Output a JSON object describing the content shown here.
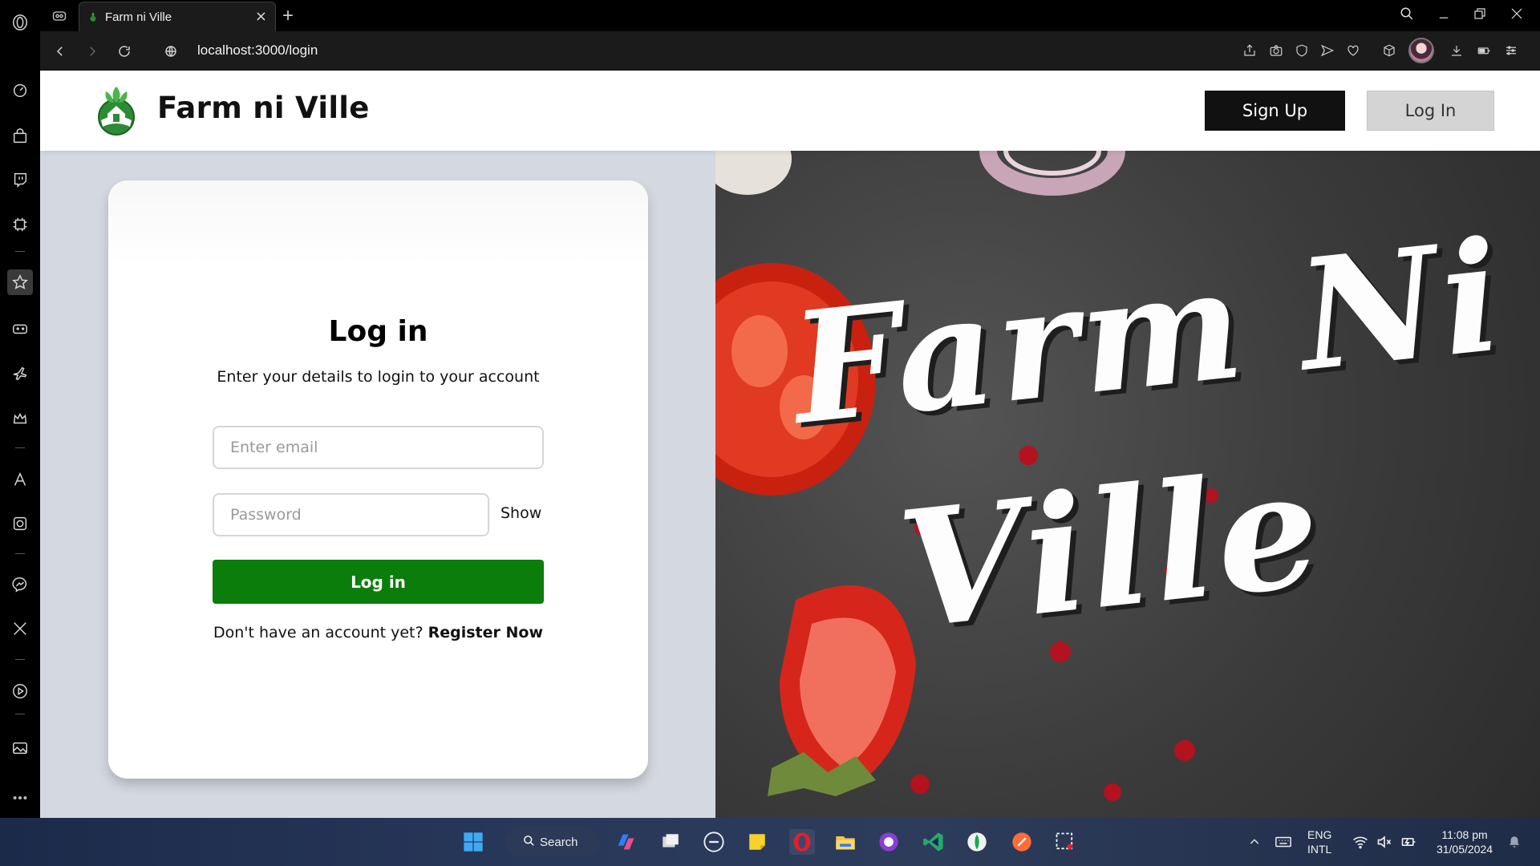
{
  "browser": {
    "tab_title": "Farm ni Ville",
    "url": "localhost:3000/login",
    "new_tab_symbol": "+",
    "tab_close_symbol": "×"
  },
  "sidebar_icons": [
    "opera-logo-icon",
    "speed-dial-icon",
    "shopping-bag-icon",
    "twitch-icon",
    "chip-icon",
    "favorites-icon",
    "gamepad-icon",
    "travel-plane-icon",
    "crown-icon",
    "aria-icon",
    "chatgpt-icon",
    "messenger-icon",
    "x-twitter-icon",
    "player-icon",
    "gallery-icon",
    "more-icon"
  ],
  "site": {
    "brand": "Farm ni Ville",
    "signup_label": "Sign Up",
    "login_label": "Log In"
  },
  "login_card": {
    "title": "Log in",
    "subtitle": "Enter your details to login to your account",
    "email_placeholder": "Enter email",
    "password_placeholder": "Password",
    "show_label": "Show",
    "submit_label": "Log in",
    "register_prompt": "Don't have an account yet?",
    "register_link": "Register Now"
  },
  "hero": {
    "line1": "Farm Ni",
    "line2": "Ville"
  },
  "taskbar": {
    "search_label": "Search",
    "language_top": "ENG",
    "language_bottom": "INTL",
    "time": "11:08 pm",
    "date": "31/05/2024"
  },
  "colors": {
    "primary_green": "#0a7d0a",
    "header_button_dark": "#111111",
    "header_button_light": "#d4d4d4",
    "left_pane_bg": "#d4d8e0"
  }
}
